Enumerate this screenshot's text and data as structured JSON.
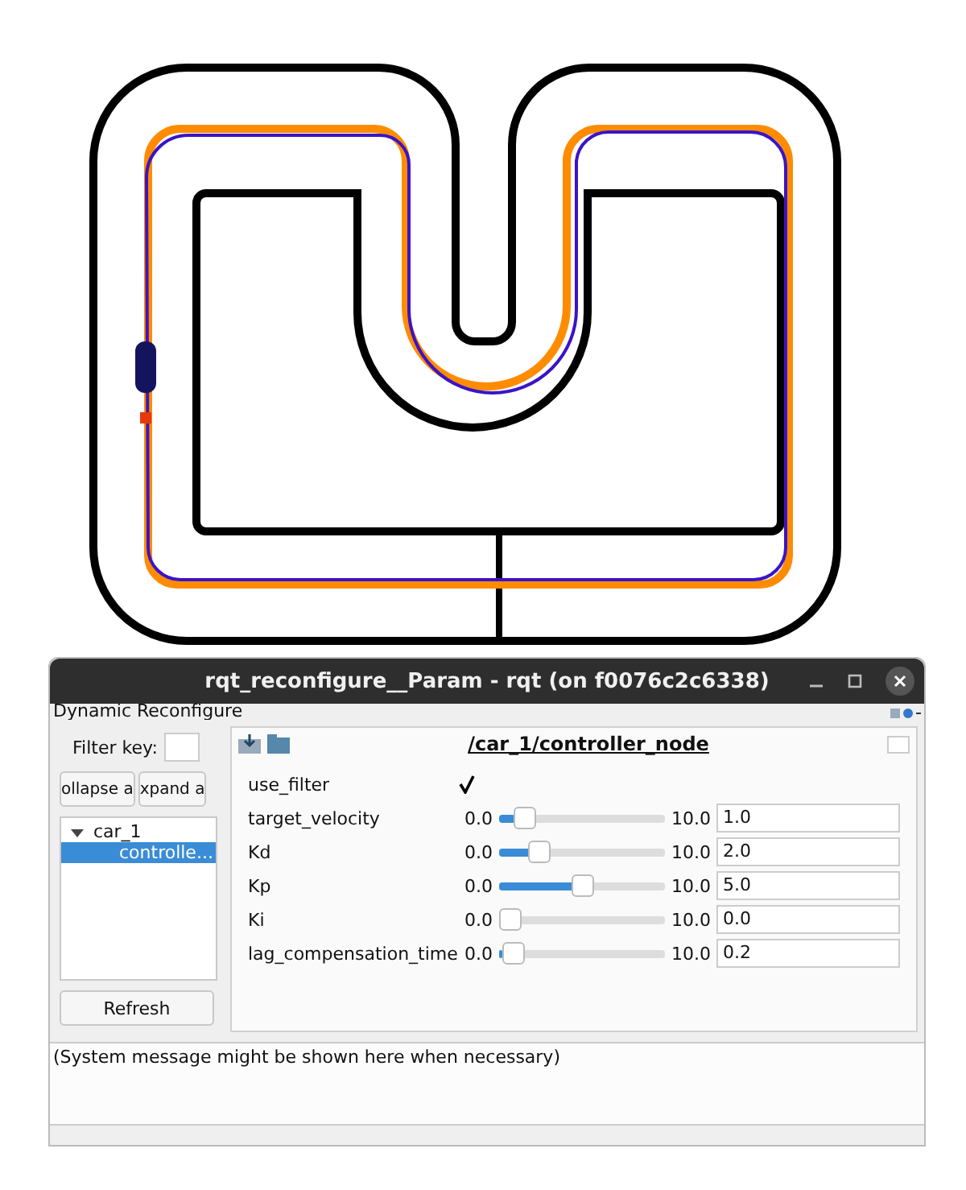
{
  "window": {
    "title": "rqt_reconfigure__Param - rqt (on f0076c2c6338)"
  },
  "plugin_title": "Dynamic Reconfigure",
  "filter": {
    "label": "Filter key:"
  },
  "tree_buttons": [
    "ollapse a",
    "xpand a"
  ],
  "tree": [
    {
      "label": "car_1",
      "expanded": true,
      "selected": false,
      "children": [
        {
          "label": "controlle...",
          "selected": true
        }
      ]
    }
  ],
  "refresh_button": "Refresh",
  "node_title": "/car_1/controller_node",
  "params": [
    {
      "kind": "checkbox",
      "name": "use_filter",
      "checked": true
    },
    {
      "kind": "slider",
      "name": "target_velocity",
      "min": "0.0",
      "max": "10.0",
      "value": "1.0",
      "level": 0.1
    },
    {
      "kind": "slider",
      "name": "Kd",
      "min": "0.0",
      "max": "10.0",
      "value": "2.0",
      "level": 0.2
    },
    {
      "kind": "slider",
      "name": "Kp",
      "min": "0.0",
      "max": "10.0",
      "value": "5.0",
      "level": 0.5
    },
    {
      "kind": "slider",
      "name": "Ki",
      "min": "0.0",
      "max": "10.0",
      "value": "0.0",
      "level": 0.0
    },
    {
      "kind": "slider",
      "name": "lag_compensation_time",
      "min": "0.0",
      "max": "10.0",
      "value": "0.2",
      "level": 0.02
    }
  ],
  "status_message": "(System message might be shown here when necessary)"
}
